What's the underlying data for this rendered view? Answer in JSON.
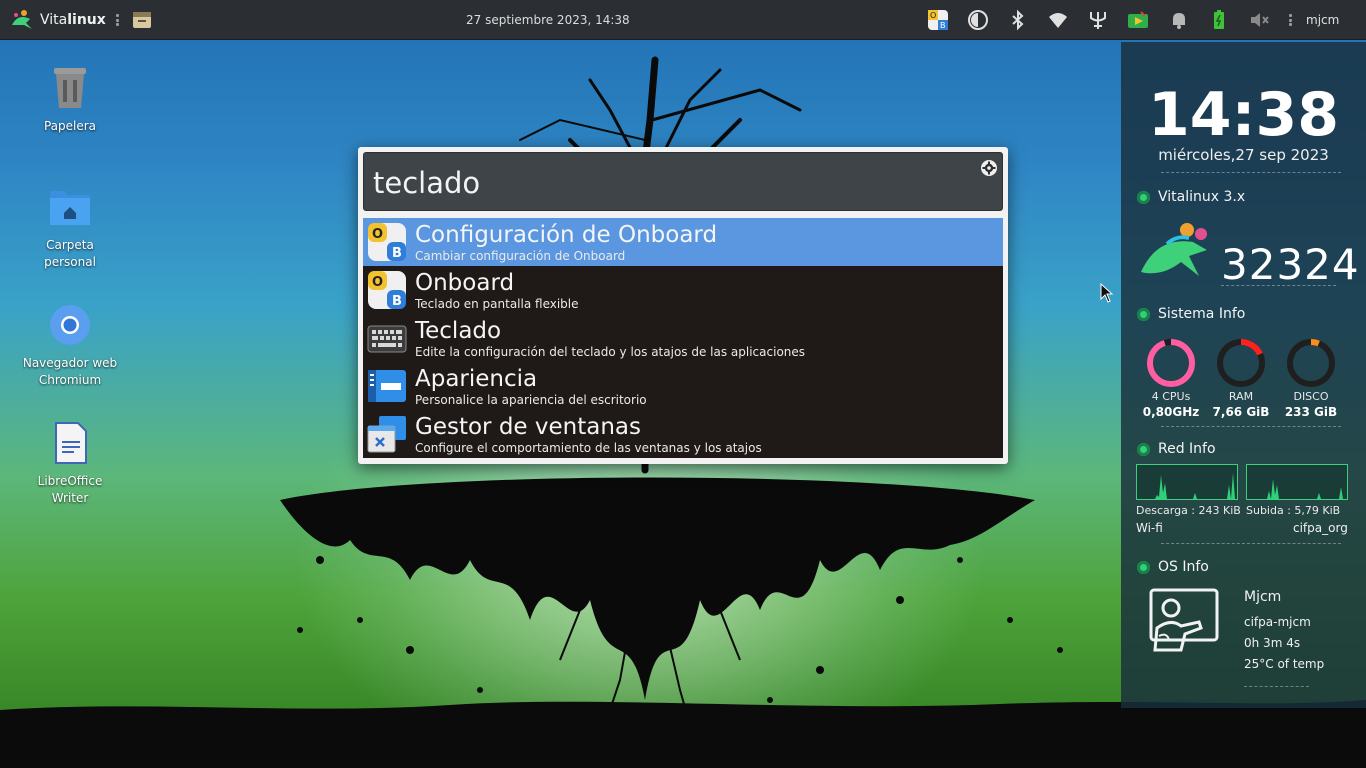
{
  "panel": {
    "brand_prefix": "Vita",
    "brand_bold": "linux",
    "datetime": "27 septiembre 2023, 14:38",
    "user": "mjcm"
  },
  "desktop_icons": [
    {
      "label": "Papelera",
      "icon": "trash-icon"
    },
    {
      "label": "Carpeta personal",
      "icon": "home-folder-icon"
    },
    {
      "label": "Navegador web Chromium",
      "icon": "chromium-icon"
    },
    {
      "label": "LibreOffice Writer",
      "icon": "writer-icon"
    }
  ],
  "launcher": {
    "query": "teclado",
    "results": [
      {
        "title": "Configuración de Onboard",
        "desc": "Cambiar configuración de Onboard",
        "icon": "onboard-icon",
        "selected": true
      },
      {
        "title": "Onboard",
        "desc": "Teclado en pantalla flexible",
        "icon": "onboard-icon",
        "selected": false
      },
      {
        "title": "Teclado",
        "desc": "Edite la configuración del teclado y los atajos de las aplicaciones",
        "icon": "keyboard-icon",
        "selected": false
      },
      {
        "title": "Apariencia",
        "desc": "Personalice la apariencia del escritorio",
        "icon": "appearance-icon",
        "selected": false
      },
      {
        "title": "Gestor de ventanas",
        "desc": "Configure el comportamiento de las ventanas y los atajos",
        "icon": "window-manager-icon",
        "selected": false
      }
    ]
  },
  "widgets": {
    "clock": "14:38",
    "date": "miércoles,27 sep 2023",
    "vitalinux_title": "Vitalinux 3.x",
    "counter": "32324",
    "sistema_title": "Sistema Info",
    "gauges": [
      {
        "label": "4 CPUs",
        "value": "0,80GHz",
        "fraction": 0.95,
        "color": "#ff5fa2"
      },
      {
        "label": "RAM",
        "value": "7,66 GiB",
        "fraction": 0.18,
        "color": "#ff2020"
      },
      {
        "label": "DISCO",
        "value": "233 GiB",
        "fraction": 0.06,
        "color": "#ff8c1a"
      }
    ],
    "red_title": "Red Info",
    "download": "Descarga : 243 KiB",
    "upload": "Subida : 5,79 KiB",
    "iface": "Wi-fi",
    "network": "cifpa_org",
    "os_title": "OS Info",
    "os_user": "Mjcm",
    "hostname": "cifpa-mjcm",
    "uptime": "0h 3m 4s",
    "temp": "25°C of temp"
  },
  "colors": {
    "accent": "#5b97e0",
    "panel_bg": "#2b2f33",
    "widget_green": "#2fd07a"
  }
}
